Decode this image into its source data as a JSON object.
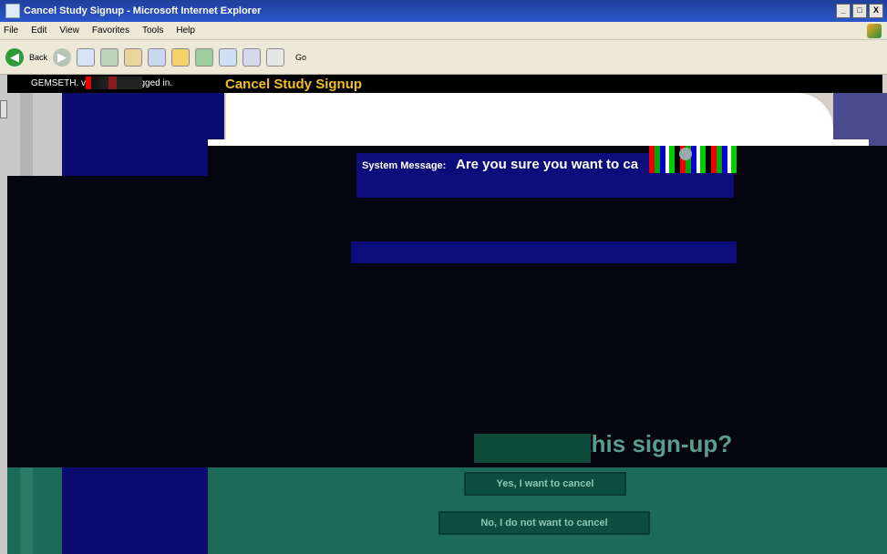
{
  "window": {
    "title": "Cancel Study Signup - Microsoft Internet Explorer",
    "controls": {
      "minimize": "_",
      "maximize": "□",
      "close": "X"
    }
  },
  "menubar": {
    "items": [
      "File",
      "Edit",
      "View",
      "Favorites",
      "Tools",
      "Help"
    ]
  },
  "toolbar": {
    "back_label": "Back",
    "go_label": "Go"
  },
  "header": {
    "login_text": "GEMSETH. v               is logged in.",
    "page_title": "Cancel Study Signup"
  },
  "system_message": {
    "label": "System Message:",
    "text": "Are you sure you want to ca"
  },
  "question": {
    "text": "this sign-up?"
  },
  "buttons": {
    "yes": "Yes, I want to cancel",
    "no": "No, I do not want to cancel"
  },
  "colors": {
    "title_yellow": "#f0c020",
    "dark_blue": "#0b0b70",
    "teal": "#1c6b57"
  }
}
